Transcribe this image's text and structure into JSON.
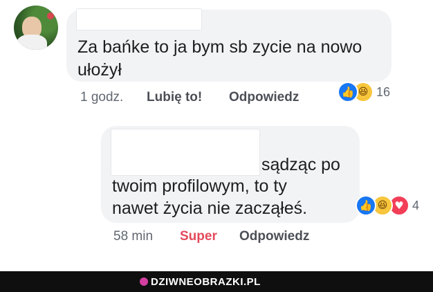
{
  "comments": [
    {
      "text_lines": [
        "Za bańke to ja bym sb zycie na nowo",
        "ułożył"
      ],
      "time": "1 godz.",
      "reaction_label": "Lubię to!",
      "reply_label": "Odpowiedz",
      "reactions": [
        "like-icon",
        "haha-icon"
      ],
      "reaction_count": "16",
      "colors": {
        "reaction_label": "#4b4f56"
      }
    },
    {
      "text_lines": [
        "sądząc po",
        "twoim profilowym, to ty",
        "nawet życia nie zacząłeś."
      ],
      "time": "58 min",
      "reaction_label": "Super",
      "reply_label": "Odpowiedz",
      "reactions": [
        "like-icon",
        "haha-icon",
        "love-icon"
      ],
      "reaction_count": "4",
      "colors": {
        "reaction_label": "#e34a5c"
      }
    }
  ],
  "watermark": {
    "text": "DZIWNEOBRAZKI.PL"
  },
  "colors": {
    "bubble": "#f2f3f5",
    "like": "#1877f2",
    "haha": "#f7c63c",
    "love": "#f33e58",
    "footer": "#0f0f0f"
  }
}
